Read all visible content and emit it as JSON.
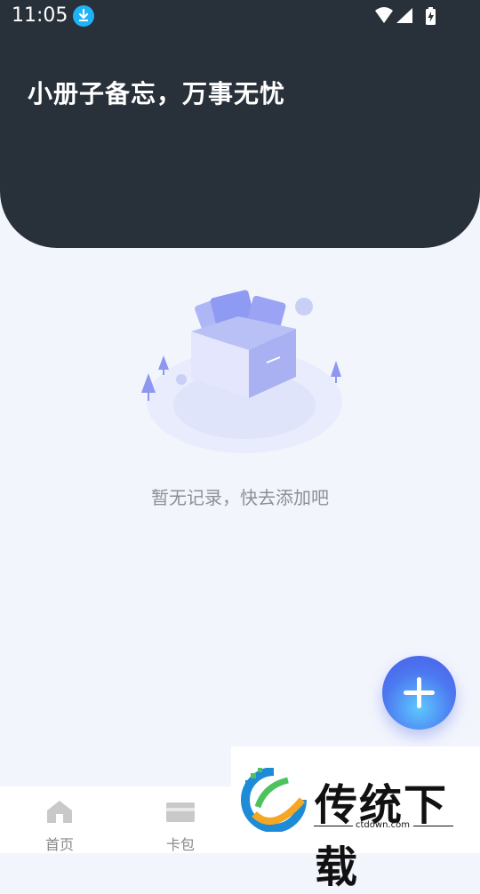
{
  "status_bar": {
    "time": "11:05"
  },
  "header": {
    "slogan": "小册子备忘，万事无忧"
  },
  "empty_state": {
    "message": "暂无记录，快去添加吧"
  },
  "fab": {
    "icon": "plus-icon"
  },
  "tabbar": {
    "tabs": [
      {
        "label": "首页",
        "icon": "home-icon"
      },
      {
        "label": "卡包",
        "icon": "wallet-icon"
      }
    ]
  },
  "watermark": {
    "text": "传统下载",
    "url": "ctdown.com"
  },
  "colors": {
    "header_bg": "#283039",
    "page_bg": "#f3f5fd",
    "accent": "#4c78f0"
  }
}
